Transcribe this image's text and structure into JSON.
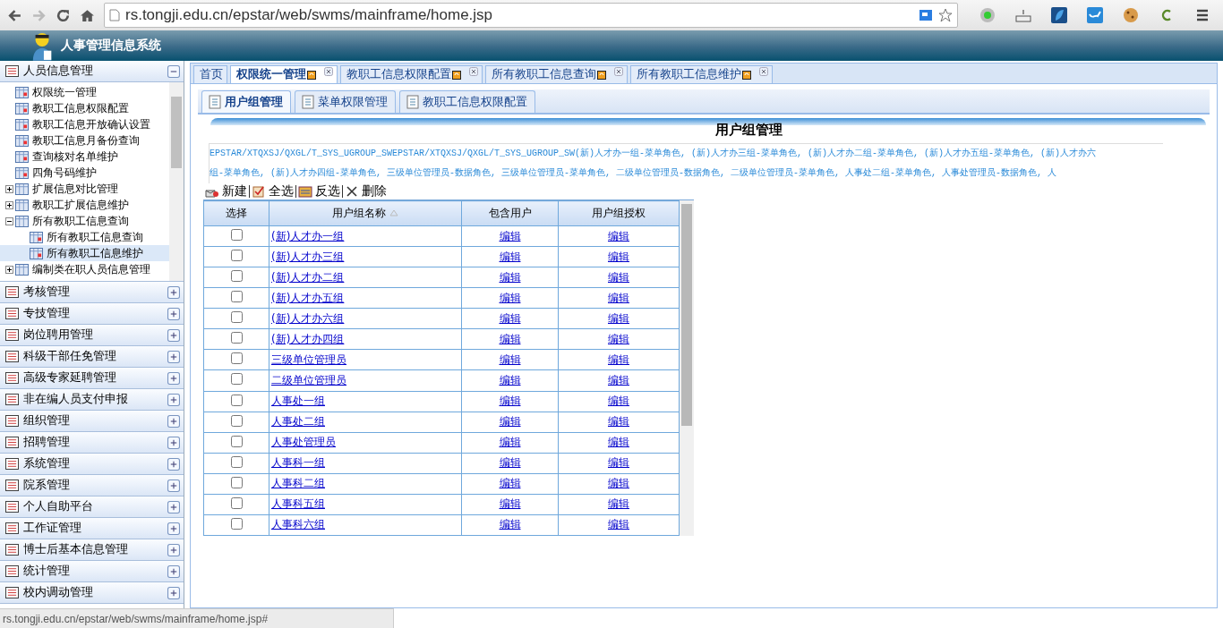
{
  "browser": {
    "url": "rs.tongji.edu.cn/epstar/web/swms/mainframe/home.jsp",
    "status_url": "rs.tongji.edu.cn/epstar/web/swms/mainframe/home.jsp#"
  },
  "app": {
    "title": "人事管理信息系统"
  },
  "sidebar": {
    "open_section": {
      "title": "人员信息管理",
      "expanded": true,
      "tree": [
        {
          "label": "权限统一管理",
          "selected": false
        },
        {
          "label": "教职工信息权限配置",
          "selected": false
        },
        {
          "label": "教职工信息开放确认设置",
          "selected": false
        },
        {
          "label": "教职工信息月备份查询",
          "selected": false
        },
        {
          "label": "查询核对名单维护",
          "selected": false
        },
        {
          "label": "四角号码维护",
          "selected": false
        },
        {
          "label": "扩展信息对比管理",
          "selected": false,
          "expanded": false
        },
        {
          "label": "教职工扩展信息维护",
          "selected": false,
          "expanded": false
        },
        {
          "label": "所有教职工信息查询",
          "selected": false,
          "expanded": true,
          "children": [
            {
              "label": "所有教职工信息查询",
              "selected": false
            },
            {
              "label": "所有教职工信息维护",
              "selected": true
            }
          ]
        },
        {
          "label": "编制类在职人员信息管理",
          "selected": false,
          "expanded": false
        }
      ]
    },
    "sections": [
      {
        "title": "考核管理",
        "expanded": false
      },
      {
        "title": "专技管理",
        "expanded": false
      },
      {
        "title": "岗位聘用管理",
        "expanded": false
      },
      {
        "title": "科级干部任免管理",
        "expanded": false
      },
      {
        "title": "高级专家延聘管理",
        "expanded": false
      },
      {
        "title": "非在编人员支付申报",
        "expanded": false
      },
      {
        "title": "组织管理",
        "expanded": false
      },
      {
        "title": "招聘管理",
        "expanded": false
      },
      {
        "title": "系统管理",
        "expanded": false
      },
      {
        "title": "院系管理",
        "expanded": false
      },
      {
        "title": "个人自助平台",
        "expanded": false
      },
      {
        "title": "工作证管理",
        "expanded": false
      },
      {
        "title": "博士后基本信息管理",
        "expanded": false
      },
      {
        "title": "统计管理",
        "expanded": false
      },
      {
        "title": "校内调动管理",
        "expanded": false
      }
    ]
  },
  "tabs": [
    {
      "label": "首页",
      "selected": false,
      "closable": false
    },
    {
      "label": "权限统一管理",
      "selected": true,
      "closable": true
    },
    {
      "label": "教职工信息权限配置",
      "selected": false,
      "closable": true
    },
    {
      "label": "所有教职工信息查询",
      "selected": false,
      "closable": true
    },
    {
      "label": "所有教职工信息维护",
      "selected": false,
      "closable": true
    }
  ],
  "subtabs": [
    {
      "label": "用户组管理",
      "selected": true
    },
    {
      "label": "菜单权限管理",
      "selected": false
    },
    {
      "label": "教职工信息权限配置",
      "selected": false
    }
  ],
  "panel": {
    "title": "用户组管理",
    "info_lines": [
      "EPSTAR/XTQXSJ/QXGL/T_SYS_UGROUP_SWEPSTAR/XTQXSJ/QXGL/T_SYS_UGROUP_SW(新)人才办一组-菜单角色, (新)人才办三组-菜单角色, (新)人才办二组-菜单角色, (新)人才办五组-菜单角色, (新)人才办六",
      "组-菜单角色, (新)人才办四组-菜单角色, 三级单位管理员-数据角色, 三级单位管理员-菜单角色, 二级单位管理员-数据角色, 二级单位管理员-菜单角色, 人事处二组-菜单角色, 人事处管理员-数据角色, 人"
    ]
  },
  "toolbar": [
    {
      "label": "新建",
      "kind": "new"
    },
    {
      "label": "全选",
      "kind": "selectall"
    },
    {
      "label": "反选",
      "kind": "invert"
    },
    {
      "label": "删除",
      "kind": "delete"
    }
  ],
  "table": {
    "columns": [
      "选择",
      "用户组名称",
      "包含用户",
      "用户组授权"
    ],
    "rows": [
      {
        "name": "(新)人才办一组",
        "checked": false,
        "users": "编辑",
        "grant": "编辑"
      },
      {
        "name": "(新)人才办三组",
        "checked": false,
        "users": "编辑",
        "grant": "编辑"
      },
      {
        "name": "(新)人才办二组",
        "checked": false,
        "users": "编辑",
        "grant": "编辑"
      },
      {
        "name": "(新)人才办五组",
        "checked": false,
        "users": "编辑",
        "grant": "编辑"
      },
      {
        "name": "(新)人才办六组",
        "checked": false,
        "users": "编辑",
        "grant": "编辑"
      },
      {
        "name": "(新)人才办四组",
        "checked": false,
        "users": "编辑",
        "grant": "编辑"
      },
      {
        "name": "三级单位管理员",
        "checked": false,
        "users": "编辑",
        "grant": "编辑"
      },
      {
        "name": "二级单位管理员",
        "checked": false,
        "users": "编辑",
        "grant": "编辑"
      },
      {
        "name": "人事处一组",
        "checked": false,
        "users": "编辑",
        "grant": "编辑"
      },
      {
        "name": "人事处二组",
        "checked": false,
        "users": "编辑",
        "grant": "编辑"
      },
      {
        "name": "人事处管理员",
        "checked": false,
        "users": "编辑",
        "grant": "编辑"
      },
      {
        "name": "人事科一组",
        "checked": false,
        "users": "编辑",
        "grant": "编辑"
      },
      {
        "name": "人事科二组",
        "checked": false,
        "users": "编辑",
        "grant": "编辑"
      },
      {
        "name": "人事科五组",
        "checked": false,
        "users": "编辑",
        "grant": "编辑"
      },
      {
        "name": "人事科六组",
        "checked": false,
        "users": "编辑",
        "grant": "编辑"
      }
    ]
  }
}
